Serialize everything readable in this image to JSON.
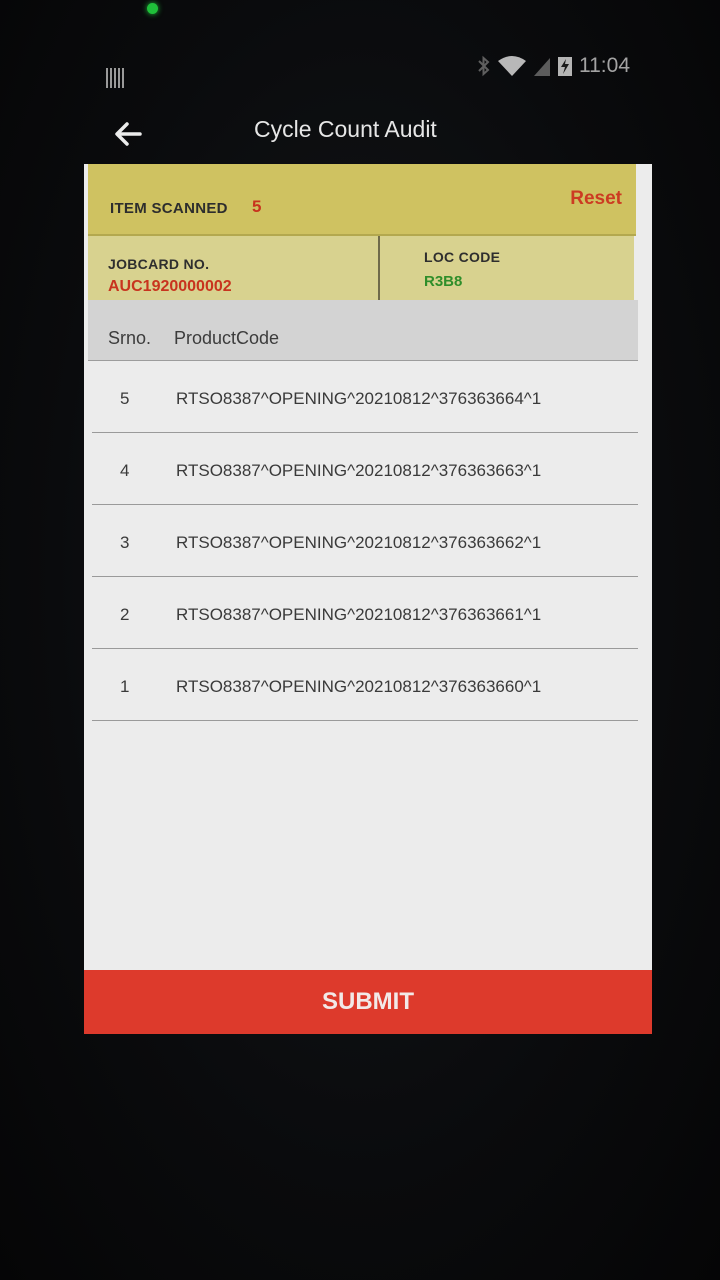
{
  "status_bar": {
    "time": "11:04",
    "icons": [
      "barcode-icon",
      "bluetooth-icon",
      "wifi-icon",
      "signal-icon",
      "battery-charging-icon"
    ]
  },
  "app_bar": {
    "back_icon": "arrow-left-icon",
    "title": "Cycle Count Audit"
  },
  "scan_summary": {
    "label": "ITEM SCANNED",
    "count": "5",
    "reset_label": "Reset"
  },
  "info": {
    "jobcard_label": "JOBCARD NO.",
    "jobcard_value": "AUC1920000002",
    "loc_label": "LOC CODE",
    "loc_value": "R3B8"
  },
  "table": {
    "headers": [
      "Srno.",
      "ProductCode"
    ],
    "rows": [
      {
        "srno": "5",
        "code": "RTSO8387^OPENING^20210812^376363664^1"
      },
      {
        "srno": "4",
        "code": "RTSO8387^OPENING^20210812^376363663^1"
      },
      {
        "srno": "3",
        "code": "RTSO8387^OPENING^20210812^376363662^1"
      },
      {
        "srno": "2",
        "code": "RTSO8387^OPENING^20210812^376363661^1"
      },
      {
        "srno": "1",
        "code": "RTSO8387^OPENING^20210812^376363660^1"
      }
    ]
  },
  "actions": {
    "submit_label": "SUBMIT"
  },
  "colors": {
    "header_yellow": "#cfc261",
    "info_yellow": "#d8d28f",
    "accent_red": "#dd3a2c",
    "loc_green": "#2f8e2a"
  }
}
